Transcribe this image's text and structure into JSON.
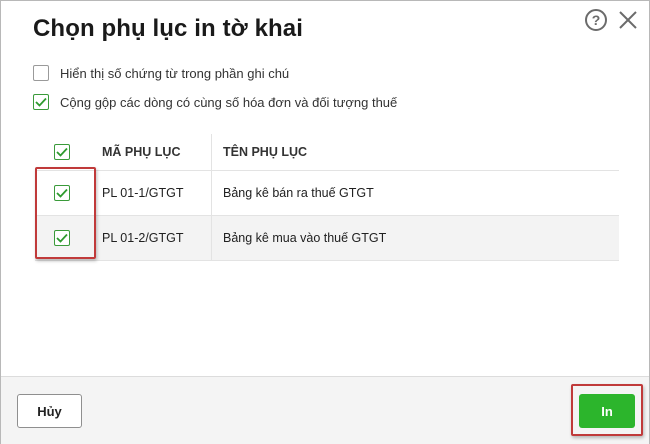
{
  "dialog": {
    "title": "Chọn phụ lục in tờ khai",
    "help_label": "?"
  },
  "options": [
    {
      "label": "Hiển thị số chứng từ trong phần ghi chú",
      "checked": false
    },
    {
      "label": "Cộng gộp các dòng có cùng số hóa đơn và đối tượng thuế",
      "checked": true
    }
  ],
  "table": {
    "columns": [
      "MÃ PHỤ LỤC",
      "TÊN PHỤ LỤC"
    ],
    "select_all_checked": true,
    "rows": [
      {
        "code": "PL 01-1/GTGT",
        "name": "Bảng kê bán ra thuế GTGT",
        "checked": true
      },
      {
        "code": "PL 01-2/GTGT",
        "name": "Bảng kê mua vào thuế GTGT",
        "checked": true
      }
    ]
  },
  "footer": {
    "cancel_label": "Hủy",
    "print_label": "In"
  },
  "colors": {
    "accent_green": "#2cb52c",
    "checkmark_green": "#2e9a2e",
    "highlight_red": "#c03a3a"
  }
}
